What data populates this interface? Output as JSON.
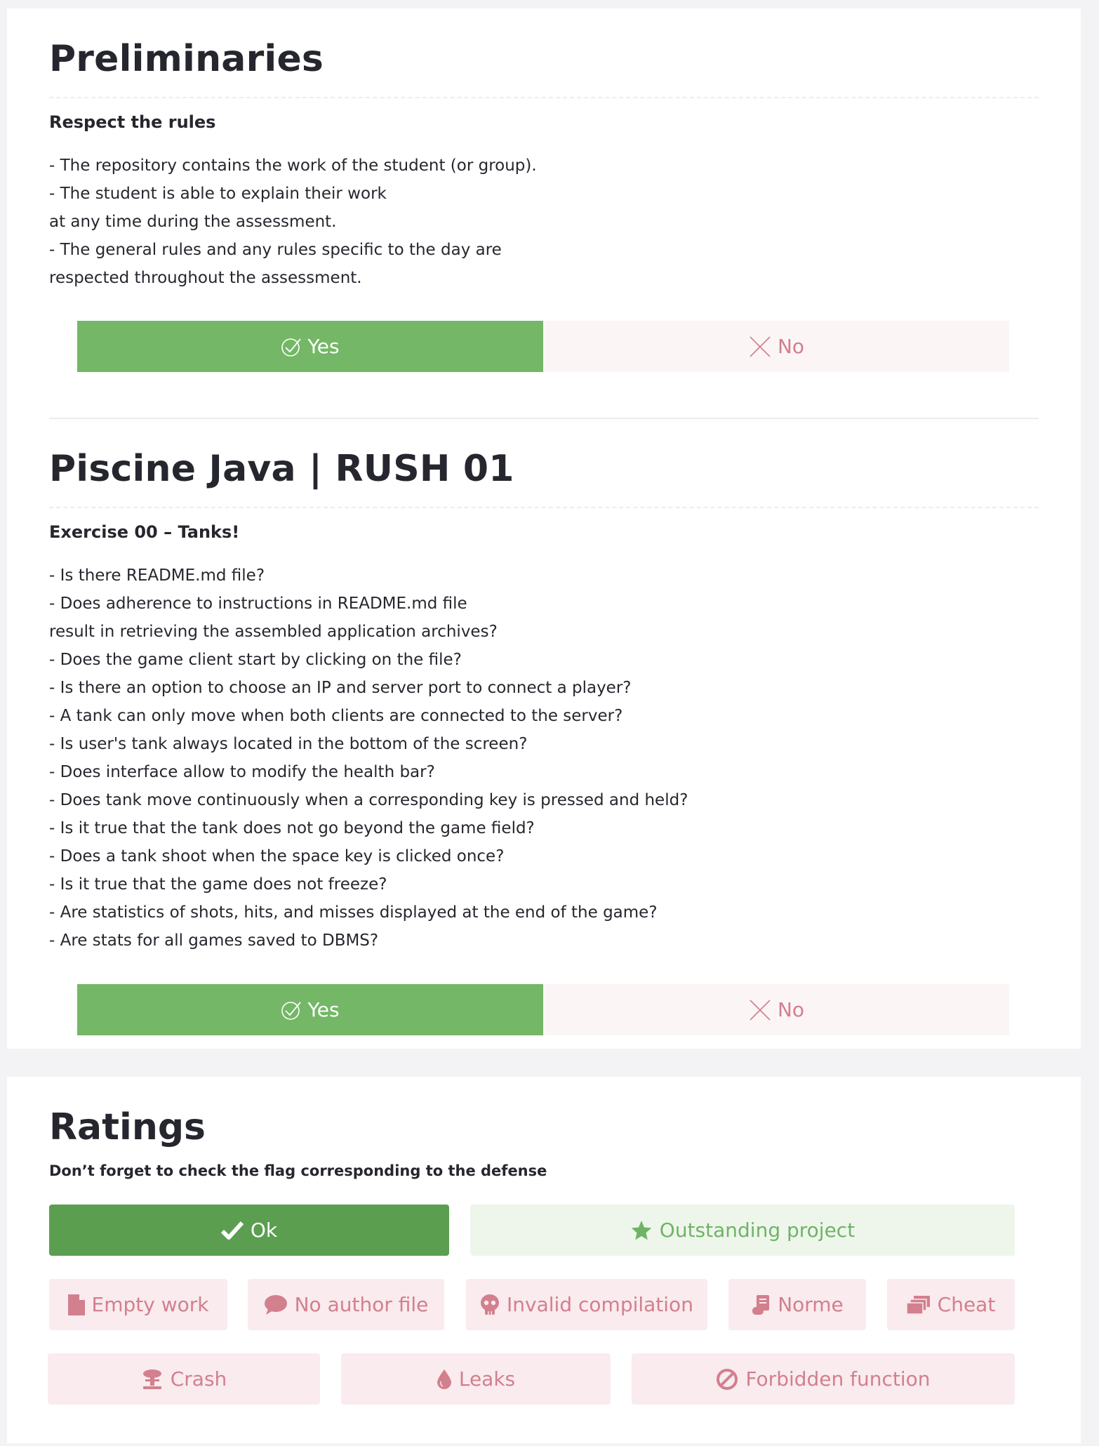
{
  "preliminaries": {
    "title": "Preliminaries",
    "subtitle": "Respect the rules",
    "lines": [
      "- The repository contains the work of the student (or group).",
      "- The student is able to explain their work",
      "at any time during the assessment.",
      "- The general rules and any rules specific to the day are",
      "respected throughout the assessment."
    ],
    "yes_label": "Yes",
    "no_label": "No",
    "selected": "yes"
  },
  "project": {
    "title": "Piscine Java | RUSH 01",
    "exercise_title": "Exercise 00 – Tanks!",
    "lines": [
      "- Is there README.md file?",
      "- Does adherence to instructions in README.md file",
      "result in retrieving the assembled application archives?",
      "- Does the game client start by clicking on the file?",
      "- Is there an option to choose an IP and server port to connect a player?",
      "- A tank can only move when both clients are connected to the server?",
      "- Is user's tank always located in the bottom of the screen?",
      "- Does interface allow to modify the health bar?",
      "- Does tank move continuously when a corresponding key is pressed and held?",
      "- Is it true that the tank does not go beyond the game field?",
      "- Does a tank shoot when the space key is clicked once?",
      "- Is it true that the game does not freeze?",
      "- Are statistics of shots, hits, and misses displayed at the end of the game?",
      "- Are stats for all games saved to DBMS?"
    ],
    "yes_label": "Yes",
    "no_label": "No",
    "selected": "yes"
  },
  "ratings": {
    "title": "Ratings",
    "note": "Don’t forget to check the flag corresponding to the defense",
    "flags": {
      "ok": {
        "label": "Ok",
        "icon": "check-icon",
        "selected": true
      },
      "outstanding": {
        "label": "Outstanding project",
        "icon": "star-icon"
      },
      "empty": {
        "label": "Empty work",
        "icon": "file-icon"
      },
      "no_author": {
        "label": "No author file",
        "icon": "speech-bubble-icon"
      },
      "invalid": {
        "label": "Invalid compilation",
        "icon": "skull-icon"
      },
      "norme": {
        "label": "Norme",
        "icon": "scroll-icon"
      },
      "cheat": {
        "label": "Cheat",
        "icon": "copy-icon"
      },
      "crash": {
        "label": "Crash",
        "icon": "explosion-icon"
      },
      "leaks": {
        "label": "Leaks",
        "icon": "drop-icon"
      },
      "forbidden": {
        "label": "Forbidden function",
        "icon": "ban-icon"
      }
    }
  },
  "colors": {
    "yes_green": "#74b766",
    "ok_green": "#5b9e50",
    "no_pink": "#d27f8e",
    "outstanding_green": "#6fb465"
  }
}
